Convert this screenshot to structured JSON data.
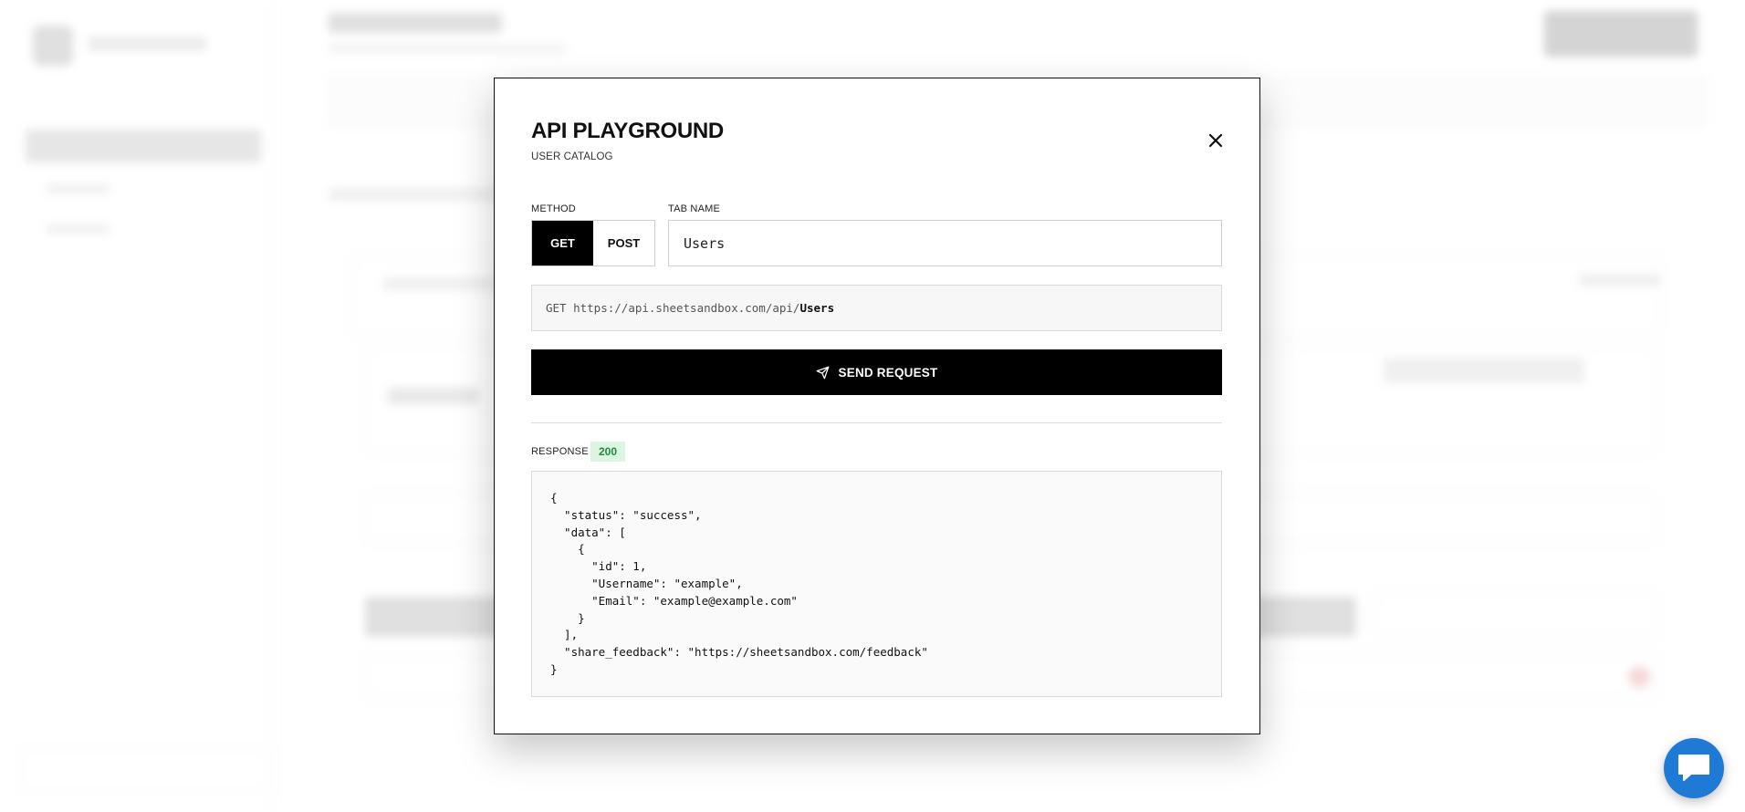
{
  "modal": {
    "title": "API PLAYGROUND",
    "subtitle": "USER CATALOG",
    "method_label": "METHOD",
    "methods": [
      "GET",
      "POST"
    ],
    "selected_method": "GET",
    "tab_name_label": "TAB NAME",
    "tab_name_value": "Users",
    "url": {
      "method": "GET",
      "base": "https://api.sheetsandbox.com/api/",
      "endpoint": "Users"
    },
    "send_label": "SEND REQUEST",
    "response_label": "RESPONSE",
    "status_code": "200",
    "response_body": "{\n  \"status\": \"success\",\n  \"data\": [\n    {\n      \"id\": 1,\n      \"Username\": \"example\",\n      \"Email\": \"example@example.com\"\n    }\n  ],\n  \"share_feedback\": \"https://sheetsandbox.com/feedback\"\n}"
  },
  "icons": {
    "close": "close-icon",
    "send": "send-icon",
    "chat": "chat-icon"
  },
  "colors": {
    "primary": "#000000",
    "status_ok_bg": "#dcf5e1",
    "status_ok_text": "#1f8a3b",
    "chat_widget": "#1f7ad6"
  }
}
